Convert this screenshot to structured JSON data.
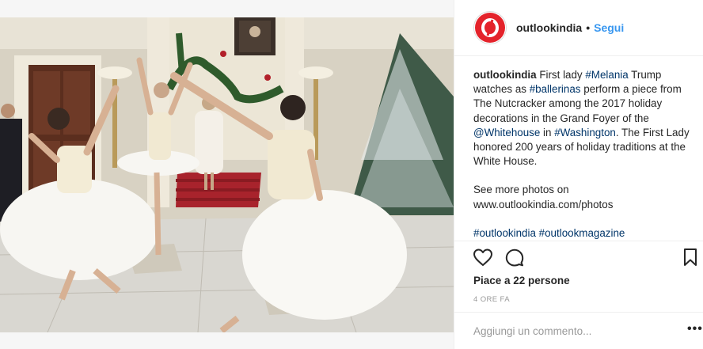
{
  "post": {
    "photo": {
      "alt_icon": "photo-ballerinas"
    },
    "account": {
      "username": "outlookindia",
      "avatar_icon": "outlook-logo-icon",
      "follow_label": "Segui",
      "separator": "•"
    },
    "caption": {
      "username": "outlookindia",
      "segments": {
        "t1": " First lady ",
        "h1": "#Melania",
        "t2": " Trump watches as ",
        "h2": "#ballerinas",
        "t3": " perform a piece from The Nutcracker among the 2017 holiday decorations in the Grand Foyer of the ",
        "h3": "@Whitehouse",
        "t4": " in ",
        "h4": "#Washington",
        "t5": ". The First Lady honored 200 years of holiday traditions at the White House."
      },
      "see_more": "See more photos on",
      "url": "www.outlookindia.com/photos",
      "tag1": "#outlookindia",
      "tag2": "#outlookmagazine"
    },
    "actions": {
      "like_icon": "heart-icon",
      "comment_icon": "comment-icon",
      "save_icon": "bookmark-icon"
    },
    "likes_text": "Piace a 22 persone",
    "time_text": "4 ORE FA",
    "comment_placeholder": "Aggiungi un commento...",
    "more_label": "•••",
    "colors": {
      "link": "#003569",
      "follow": "#3897f0",
      "brand_red": "#e4232b",
      "muted": "#999999"
    }
  }
}
